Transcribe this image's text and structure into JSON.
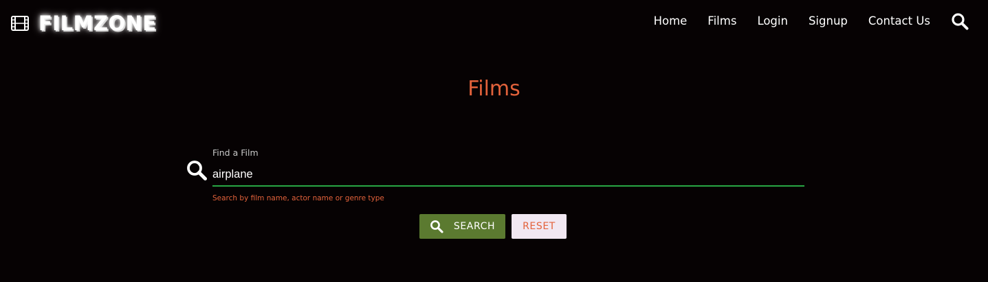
{
  "navbar": {
    "brand_icon": "film-icon",
    "brand_name": "FILMZONE",
    "links": [
      "Home",
      "Films",
      "Login",
      "Signup",
      "Contact Us"
    ],
    "search_icon": "search-icon"
  },
  "main": {
    "title": "Films",
    "search_field": {
      "icon": "search-icon",
      "label": "Find a Film",
      "value": "airplane",
      "help_text": "Search by film name, actor name or genre type"
    },
    "buttons": {
      "search_icon": "search-icon",
      "search_label": "SEARCH",
      "reset_label": "RESET"
    }
  },
  "colors": {
    "background": "#060203",
    "accent": "#e3623b",
    "input_underline": "#28a745",
    "search_button": "#5b7a30",
    "reset_button": "#f1e8f2"
  }
}
